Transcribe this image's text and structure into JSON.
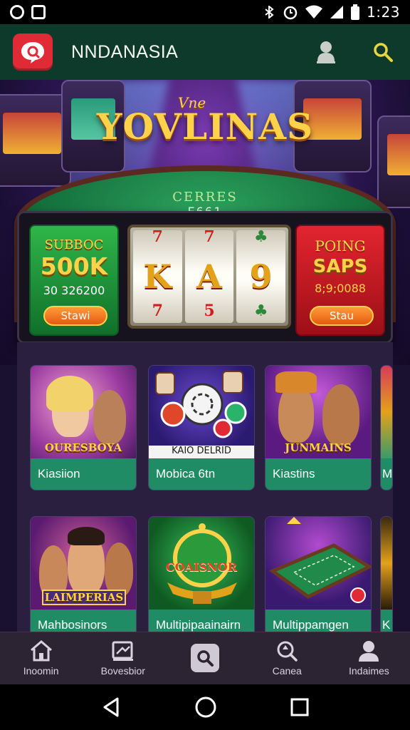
{
  "status_bar": {
    "time": "1:23"
  },
  "app_bar": {
    "title": "NNDANASIA"
  },
  "hero": {
    "script_text": "Vne",
    "title": "YOVLINAS",
    "table_text": "CERRES",
    "table_sub": "E661"
  },
  "featured": {
    "left_promo": {
      "heading": "SUBBOC",
      "amount": "500K",
      "code": "30 326200",
      "button": "Stawi"
    },
    "reels": [
      {
        "top": "7",
        "mid": "K",
        "bot": "7"
      },
      {
        "top": "7",
        "mid": "A",
        "bot": "5"
      },
      {
        "top": "♣",
        "mid": "9",
        "bot": "♣"
      }
    ],
    "right_promo": {
      "heading": "POING",
      "amount": "SAPS",
      "code": "8;9;0088",
      "button": "Stau"
    }
  },
  "games": [
    {
      "art_label": "OURESBOYA",
      "name": "Kiasiion"
    },
    {
      "art_label": "KAIO DELRID",
      "name": "Mobica 6tn"
    },
    {
      "art_label": "JUNMAINS",
      "name": "Kiastins"
    },
    {
      "art_label": "",
      "name": "M"
    },
    {
      "art_label": "LAIMPERIAS",
      "name": "Mahbosinors"
    },
    {
      "art_label": "COAISNOR",
      "name": "Multipipaainairn"
    },
    {
      "art_label": "",
      "name": "Multippamgen"
    },
    {
      "art_label": "",
      "name": "K"
    }
  ],
  "bottom_nav": [
    {
      "label": "Inoomin",
      "icon": "home-icon"
    },
    {
      "label": "Bovesbior",
      "icon": "board-icon"
    },
    {
      "label": "",
      "icon": "search-icon"
    },
    {
      "label": "Canea",
      "icon": "map-search-icon"
    },
    {
      "label": "Indaimes",
      "icon": "profile-icon"
    }
  ],
  "colors": {
    "app_bar": "#0e3a2c",
    "accent_red": "#e02a36",
    "card_footer": "#1f8c66",
    "gold": "#ffd24a"
  }
}
